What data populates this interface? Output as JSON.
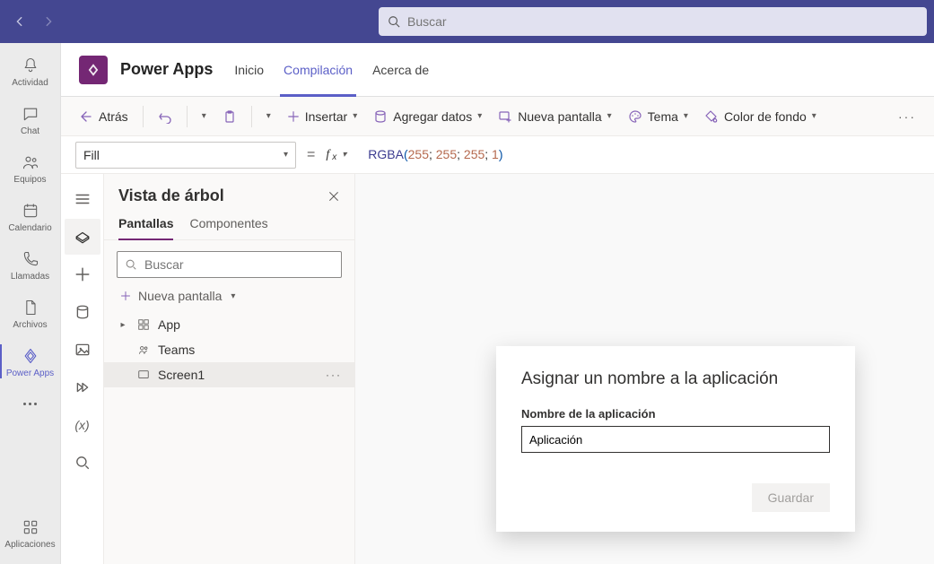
{
  "titlebar": {
    "search_placeholder": "Buscar"
  },
  "rail": {
    "items": [
      {
        "label": "Actividad"
      },
      {
        "label": "Chat"
      },
      {
        "label": "Equipos"
      },
      {
        "label": "Calendario"
      },
      {
        "label": "Llamadas"
      },
      {
        "label": "Archivos"
      },
      {
        "label": "Power Apps"
      }
    ],
    "apps_label": "Aplicaciones"
  },
  "appheader": {
    "title": "Power Apps",
    "tabs": [
      {
        "label": "Inicio"
      },
      {
        "label": "Compilación"
      },
      {
        "label": "Acerca de"
      }
    ]
  },
  "cmdbar": {
    "back": "Atrás",
    "insert": "Insertar",
    "add_data": "Agregar datos",
    "new_screen": "Nueva pantalla",
    "theme": "Tema",
    "bg_color": "Color de fondo"
  },
  "formula": {
    "property": "Fill",
    "fn": "RGBA",
    "args": [
      "255",
      "255",
      "255",
      "1"
    ]
  },
  "tree": {
    "title": "Vista de árbol",
    "tabs": {
      "screens": "Pantallas",
      "components": "Componentes"
    },
    "search_placeholder": "Buscar",
    "new_screen": "Nueva pantalla",
    "items": [
      {
        "label": "App"
      },
      {
        "label": "Teams"
      },
      {
        "label": "Screen1"
      }
    ]
  },
  "modal": {
    "title": "Asignar un nombre a la aplicación",
    "field_label": "Nombre de la aplicación",
    "field_value": "Aplicación",
    "save": "Guardar"
  }
}
